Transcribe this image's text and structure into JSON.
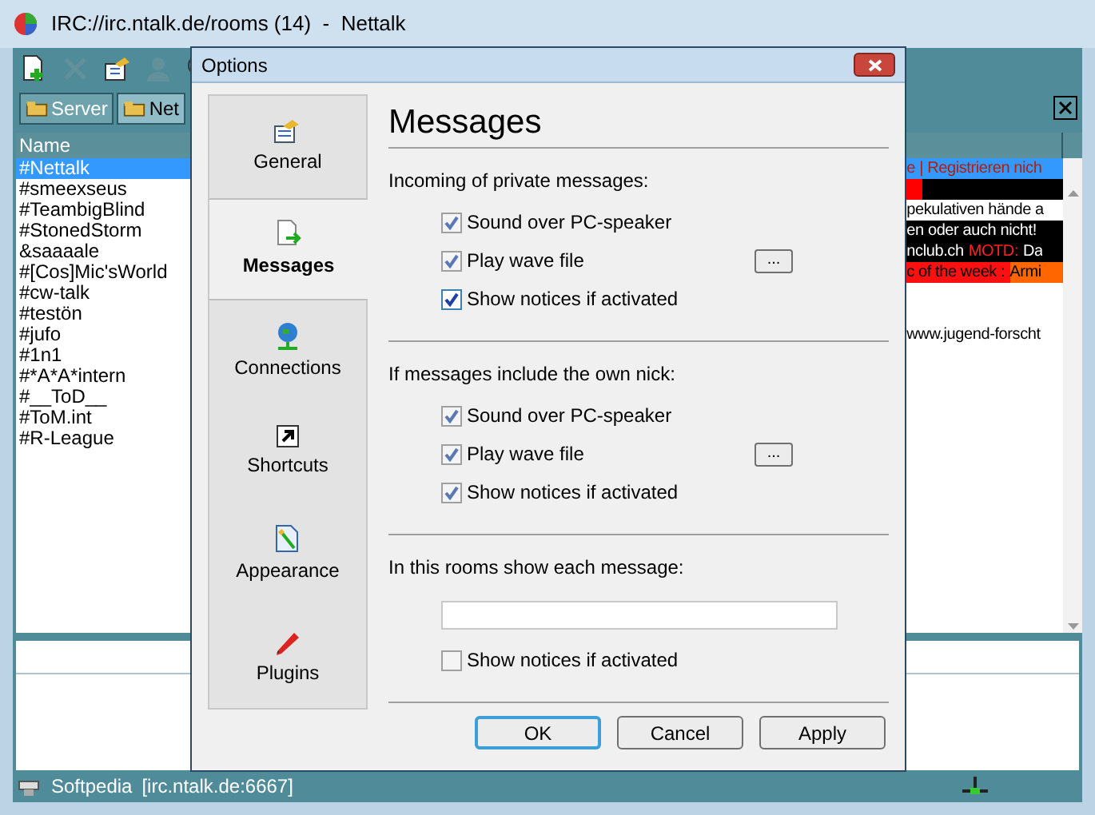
{
  "window": {
    "title": "IRC://irc.ntalk.de/rooms (14)  -  Nettalk"
  },
  "toolbar": [
    {
      "disabled": false
    },
    {
      "disabled": true
    },
    {
      "disabled": false
    },
    {
      "disabled": true
    },
    {
      "disabled": false
    }
  ],
  "tabs": [
    {
      "label": "Server",
      "selected": false
    },
    {
      "label": "Net",
      "selected": true
    }
  ],
  "channel_list": {
    "header": "Name",
    "rows": [
      {
        "label": "#Nettalk",
        "selected": true
      },
      {
        "label": "#smeexseus",
        "selected": false
      },
      {
        "label": "#TeambigBlind",
        "selected": false
      },
      {
        "label": "#StonedStorm",
        "selected": false
      },
      {
        "label": "&saaaale",
        "selected": false
      },
      {
        "label": "#[Cos]Mic'sWorld",
        "selected": false
      },
      {
        "label": "#cw-talk",
        "selected": false
      },
      {
        "label": "#testön",
        "selected": false
      },
      {
        "label": "#jufo",
        "selected": false
      },
      {
        "label": "#1n1",
        "selected": false
      },
      {
        "label": "#*A*A*intern",
        "selected": false
      },
      {
        "label": "#__ToD__",
        "selected": false
      },
      {
        "label": "#ToM.int",
        "selected": false
      },
      {
        "label": "#R-League",
        "selected": false
      }
    ]
  },
  "topic_lines": [
    {
      "kind": "text",
      "segments": [
        {
          "text": "e | Registrieren nich",
          "kind": "highlight"
        }
      ]
    },
    {
      "kind": "bar"
    },
    {
      "kind": "text",
      "segments": [
        {
          "text": "pekulativen hände a",
          "kind": "plain"
        }
      ]
    },
    {
      "kind": "text",
      "segments": [
        {
          "text": "en oder auch nicht!",
          "kind": "inverse"
        }
      ]
    },
    {
      "kind": "text",
      "segments": [
        {
          "text": "nclub.ch",
          "kind": "inverse"
        },
        {
          "text": "MOTD:",
          "kind": "alert"
        },
        {
          "text": "Da",
          "kind": "inverse"
        }
      ]
    },
    {
      "kind": "text",
      "segments": [
        {
          "text": "c of the week :",
          "kind": "red"
        },
        {
          "text": "Armi",
          "kind": "orange"
        }
      ]
    },
    {
      "kind": "blank"
    },
    {
      "kind": "blank"
    },
    {
      "kind": "text",
      "segments": [
        {
          "text": "www.jugend-forscht",
          "kind": "plain"
        }
      ]
    }
  ],
  "status_bar": {
    "nick": "Softpedia",
    "server": "[irc.ntalk.de:6667]"
  },
  "dialog": {
    "title": "Options",
    "nav": [
      {
        "label": "General",
        "selected": false
      },
      {
        "label": "Messages",
        "selected": true
      },
      {
        "label": "Connections",
        "selected": false
      },
      {
        "label": "Shortcuts",
        "selected": false
      },
      {
        "label": "Appearance",
        "selected": false
      },
      {
        "label": "Plugins",
        "selected": false
      }
    ],
    "heading": "Messages",
    "sections": [
      {
        "label": "Incoming of private messages:",
        "items": [
          {
            "kind": "checkbox",
            "label": "Sound over PC-speaker",
            "checked": true,
            "disabled": true
          },
          {
            "kind": "checkbox",
            "label": "Play wave file",
            "checked": true,
            "disabled": true,
            "browse": "..."
          },
          {
            "kind": "checkbox",
            "label": "Show notices if activated",
            "checked": true,
            "disabled": false
          }
        ]
      },
      {
        "label": "If messages include the own nick:",
        "items": [
          {
            "kind": "checkbox",
            "label": "Sound over PC-speaker",
            "checked": true,
            "disabled": true
          },
          {
            "kind": "checkbox",
            "label": "Play wave file",
            "checked": true,
            "disabled": true,
            "browse": "..."
          },
          {
            "kind": "checkbox",
            "label": "Show notices if activated",
            "checked": true,
            "disabled": true
          }
        ]
      },
      {
        "label": "In this rooms show each message:",
        "items": [
          {
            "kind": "field"
          },
          {
            "kind": "checkbox",
            "label": "Show notices if activated",
            "checked": false,
            "disabled": true
          }
        ]
      }
    ],
    "buttons": [
      {
        "label": "OK",
        "default": true
      },
      {
        "label": "Cancel",
        "default": false
      },
      {
        "label": "Apply",
        "default": false
      }
    ]
  }
}
